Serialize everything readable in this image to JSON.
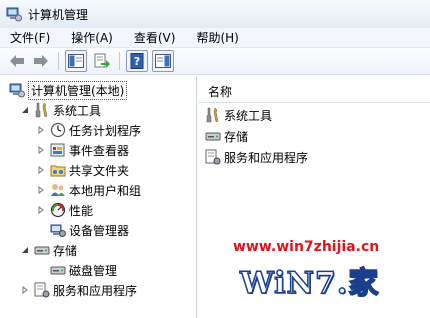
{
  "window": {
    "title": "计算机管理"
  },
  "menu": [
    "文件(F)",
    "操作(A)",
    "查看(V)",
    "帮助(H)"
  ],
  "tree": {
    "root": "计算机管理(本地)",
    "system_tools": "系统工具",
    "task_scheduler": "任务计划程序",
    "event_viewer": "事件查看器",
    "shared_folders": "共享文件夹",
    "local_users": "本地用户和组",
    "performance": "性能",
    "device_manager": "设备管理器",
    "storage": "存储",
    "disk_management": "磁盘管理",
    "services_apps": "服务和应用程序"
  },
  "list": {
    "column_name": "名称",
    "items": [
      "系统工具",
      "存储",
      "服务和应用程序"
    ]
  },
  "watermark": {
    "url": "www.win7zhijia.cn",
    "logo_text": "WiN7.家"
  }
}
